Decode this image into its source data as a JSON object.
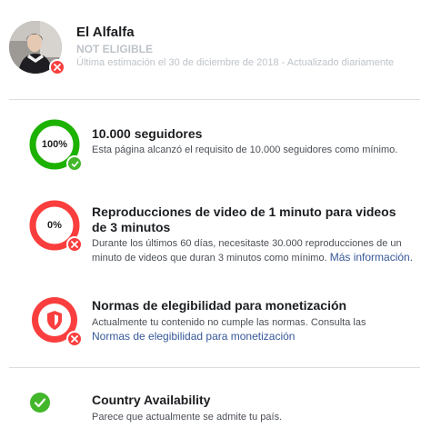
{
  "header": {
    "page_name": "El Alfalfa",
    "status": "NOT ELIGIBLE",
    "estimate": "Última estimación el 30 de diciembre de 2018 - Actualizado diariamente"
  },
  "colors": {
    "success": "#1db200",
    "fail": "#fa3e3e",
    "link": "#365899",
    "muted": "#bec3c9"
  },
  "requirements": [
    {
      "progress_label": "100%",
      "progress": 1.0,
      "status_icon": "check-icon",
      "title": "10.000 seguidores",
      "description": "Esta página alcanzó el requisito de 10.000 seguidores como mínimo."
    },
    {
      "progress_label": "0%",
      "progress": 0.0,
      "status_icon": "close-icon",
      "title": "Reproducciones de video de 1 minuto para videos de 3 minutos",
      "description": "Durante los últimos 60 días, necesitaste 30.000 reproducciones de un minuto de videos que duran 3 minutos como mínimo.",
      "link": "Más información."
    },
    {
      "icon": "shield-icon",
      "status_icon": "close-icon",
      "title": "Normas de elegibilidad para monetización",
      "description": "Actualmente tu contenido no cumple las normas. Consulta las",
      "link": "Normas de elegibilidad para monetización"
    }
  ],
  "country": {
    "status_icon": "check-circle-icon",
    "title": "Country Availability",
    "description": "Parece que actualmente se admite tu país."
  }
}
